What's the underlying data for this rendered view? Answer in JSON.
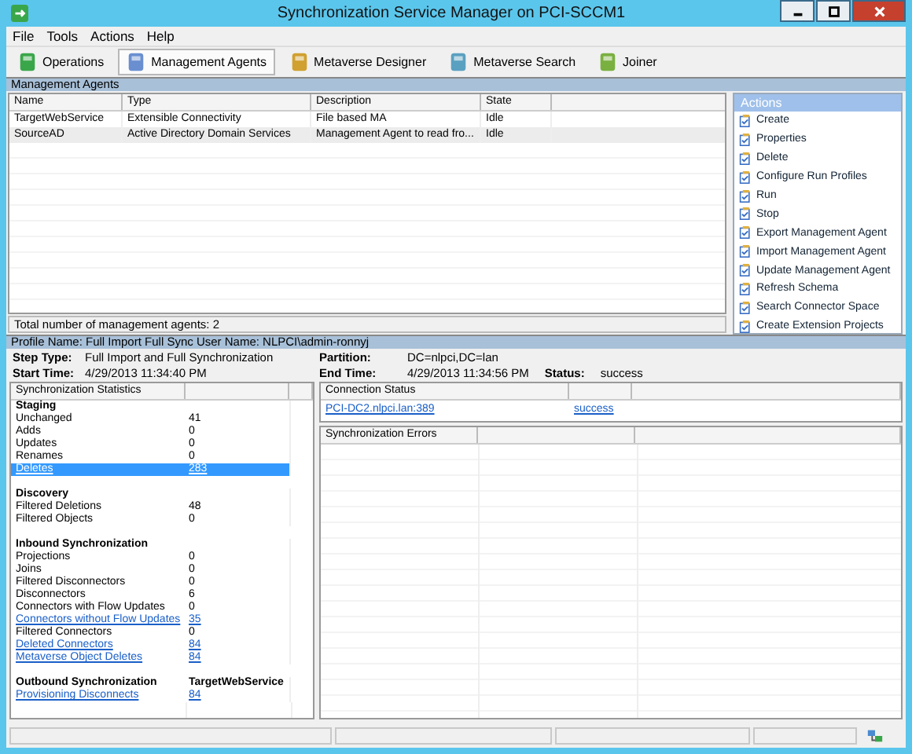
{
  "window": {
    "title": "Synchronization Service Manager on PCI-SCCM1"
  },
  "menu": [
    "File",
    "Tools",
    "Actions",
    "Help"
  ],
  "toolbar": [
    {
      "label": "Operations",
      "selected": false
    },
    {
      "label": "Management Agents",
      "selected": true
    },
    {
      "label": "Metaverse Designer",
      "selected": false
    },
    {
      "label": "Metaverse Search",
      "selected": false
    },
    {
      "label": "Joiner",
      "selected": false
    }
  ],
  "agents": {
    "title": "Management Agents",
    "columns": [
      "Name",
      "Type",
      "Description",
      "State"
    ],
    "rows": [
      {
        "cells": [
          "TargetWebService",
          "Extensible Connectivity",
          "File based MA",
          "Idle"
        ],
        "selected": false
      },
      {
        "cells": [
          "SourceAD",
          "Active Directory Domain Services",
          "Management Agent to read fro...",
          "Idle"
        ],
        "selected": true
      }
    ],
    "total": "Total number of management agents: 2"
  },
  "actions": {
    "title": "Actions",
    "items": [
      "Create",
      "Properties",
      "Delete",
      "Configure Run Profiles",
      "Run",
      "Stop",
      "Export Management Agent",
      "Import Management Agent",
      "Update Management Agent",
      "Refresh Schema",
      "Search Connector Space",
      "Create Extension Projects"
    ]
  },
  "profile": {
    "header": "Profile Name: Full Import Full Sync  User Name: NLPCI\\admin-ronnyj",
    "fields": [
      {
        "label": "Step Type:",
        "value": "Full Import and Full Synchronization"
      },
      {
        "label": "Start Time:",
        "value": "4/29/2013 11:34:40 PM"
      },
      {
        "label": "Partition:",
        "value": "DC=nlpci,DC=lan"
      },
      {
        "label": "End Time:",
        "value": "4/29/2013 11:34:56 PM"
      }
    ],
    "status_label": "Status:",
    "status": "success"
  },
  "statistics": {
    "title": "Synchronization Statistics",
    "rows": [
      {
        "kind": "heading",
        "label": "Staging",
        "selected": false
      },
      {
        "kind": "stat",
        "label": "Unchanged",
        "value": "41",
        "selected": false
      },
      {
        "kind": "stat",
        "label": "Adds",
        "value": "0",
        "selected": false
      },
      {
        "kind": "stat",
        "label": "Updates",
        "value": "0",
        "selected": false
      },
      {
        "kind": "stat",
        "label": "Renames",
        "value": "0",
        "selected": false
      },
      {
        "kind": "link",
        "label": "Deletes",
        "value": "283",
        "selected": true
      },
      {
        "kind": "heading",
        "label": "Discovery",
        "selected": false
      },
      {
        "kind": "stat",
        "label": "Filtered Deletions",
        "value": "48",
        "selected": false
      },
      {
        "kind": "stat",
        "label": "Filtered Objects",
        "value": "0",
        "selected": false
      },
      {
        "kind": "heading",
        "label": "Inbound Synchronization",
        "selected": false
      },
      {
        "kind": "stat",
        "label": "Projections",
        "value": "0",
        "selected": false
      },
      {
        "kind": "stat",
        "label": "Joins",
        "value": "0",
        "selected": false
      },
      {
        "kind": "stat",
        "label": "Filtered Disconnectors",
        "value": "0",
        "selected": false
      },
      {
        "kind": "stat",
        "label": "Disconnectors",
        "value": "6",
        "selected": false
      },
      {
        "kind": "stat",
        "label": "Connectors with Flow Updates",
        "value": "0",
        "selected": false
      },
      {
        "kind": "link",
        "label": "Connectors without Flow Updates",
        "value": "35",
        "selected": false
      },
      {
        "kind": "stat",
        "label": "Filtered Connectors",
        "value": "0",
        "selected": false
      },
      {
        "kind": "link",
        "label": "Deleted Connectors",
        "value": "84",
        "selected": false
      },
      {
        "kind": "link",
        "label": "Metaverse Object Deletes",
        "value": "84",
        "selected": false
      },
      {
        "kind": "heading",
        "label": "Outbound Synchronization",
        "value": "TargetWebService",
        "selected": false
      },
      {
        "kind": "link",
        "label": "Provisioning Disconnects",
        "value": "84",
        "selected": false
      }
    ]
  },
  "connection": {
    "title": "Connection Status",
    "server": "PCI-DC2.nlpci.lan:389",
    "result": "success"
  },
  "errors": {
    "title": "Synchronization Errors"
  }
}
